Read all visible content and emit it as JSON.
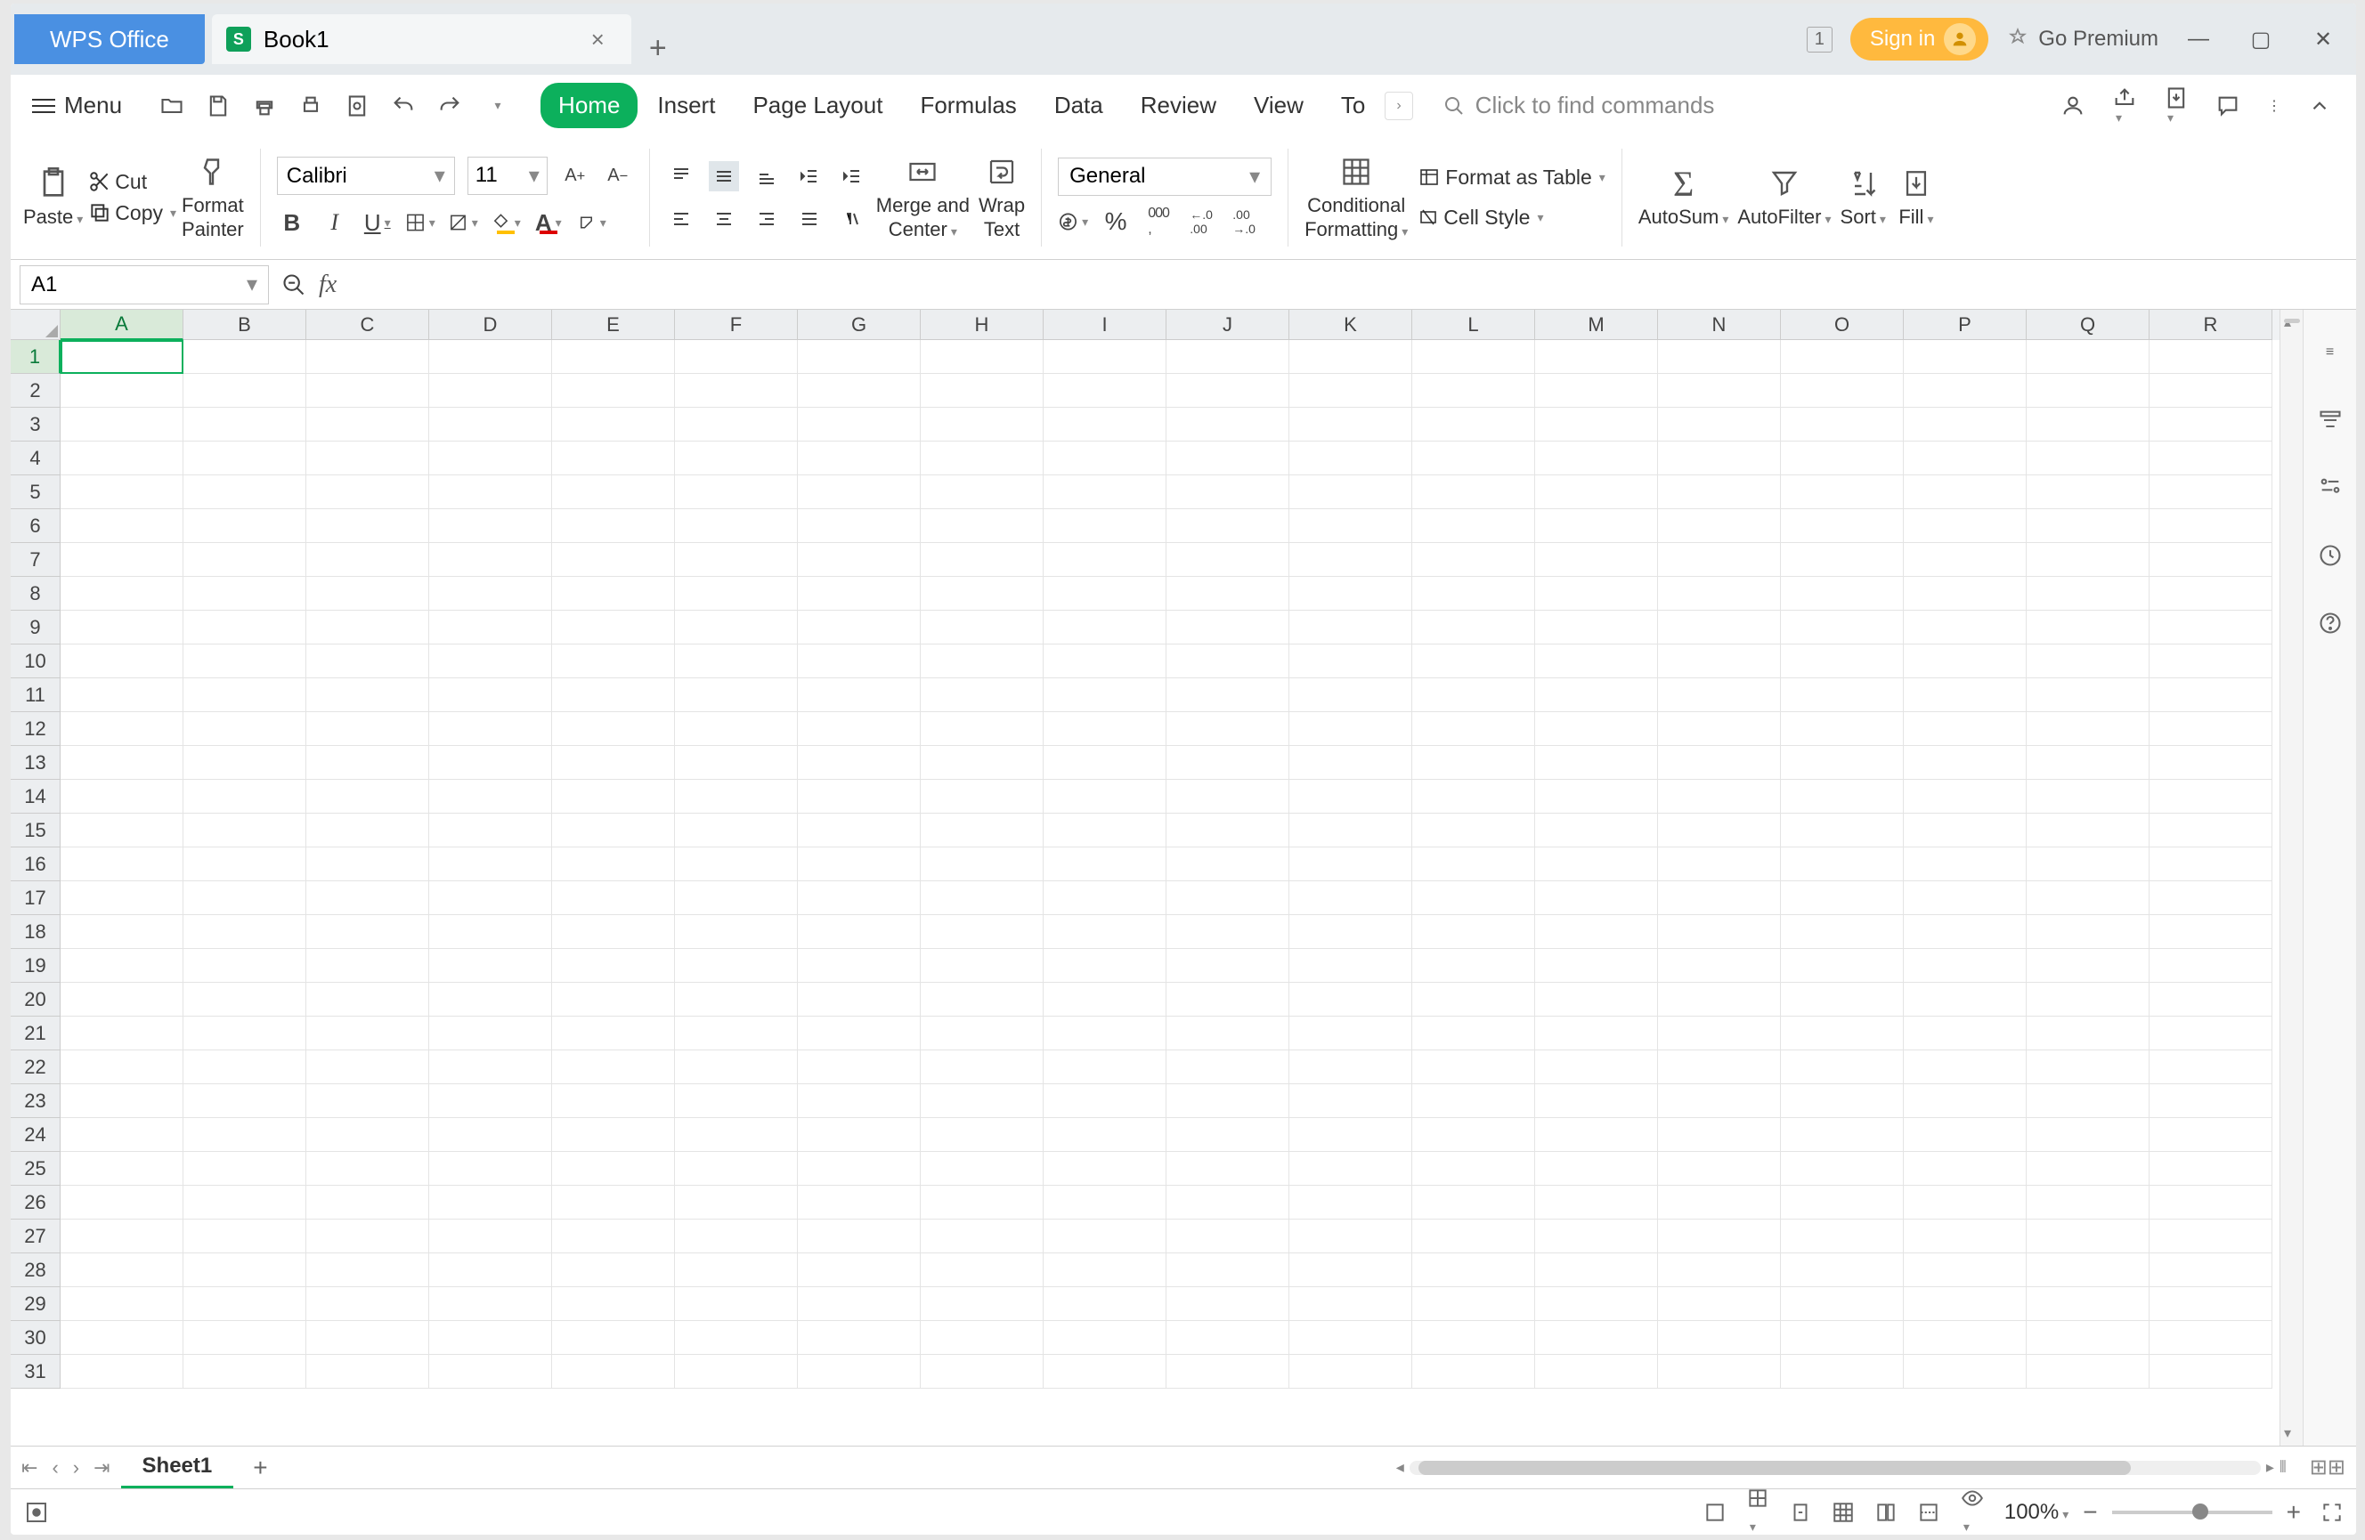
{
  "titlebar": {
    "app_tab": "WPS Office",
    "doc_name": "Book1",
    "doc_icon_letter": "S",
    "badge": "1",
    "signin": "Sign in",
    "premium": "Go Premium"
  },
  "menu": {
    "menu_label": "Menu",
    "search_placeholder": "Click to find commands",
    "tabs": [
      "Home",
      "Insert",
      "Page Layout",
      "Formulas",
      "Data",
      "Review",
      "View",
      "To"
    ],
    "active_tab": 0
  },
  "ribbon": {
    "paste": "Paste",
    "cut": "Cut",
    "copy": "Copy",
    "format_painter": "Format\nPainter",
    "font_name": "Calibri",
    "font_size": "11",
    "merge": "Merge and\nCenter",
    "wrap": "Wrap\nText",
    "number_format": "General",
    "cond_fmt": "Conditional\nFormatting",
    "fmt_table": "Format as Table",
    "cell_style": "Cell Style",
    "autosum": "AutoSum",
    "autofilter": "AutoFilter",
    "sort": "Sort",
    "fill": "Fill"
  },
  "formula": {
    "cell_ref": "A1",
    "formula_value": ""
  },
  "grid": {
    "columns": [
      "A",
      "B",
      "C",
      "D",
      "E",
      "F",
      "G",
      "H",
      "I",
      "J",
      "K",
      "L",
      "M",
      "N",
      "O",
      "P",
      "Q",
      "R"
    ],
    "rows": [
      1,
      2,
      3,
      4,
      5,
      6,
      7,
      8,
      9,
      10,
      11,
      12,
      13,
      14,
      15,
      16,
      17,
      18,
      19,
      20,
      21,
      22,
      23,
      24,
      25,
      26,
      27,
      28,
      29,
      30,
      31
    ],
    "active_cell": {
      "col": 0,
      "row": 0
    }
  },
  "sheets": {
    "active": "Sheet1"
  },
  "status": {
    "zoom": "100%"
  }
}
